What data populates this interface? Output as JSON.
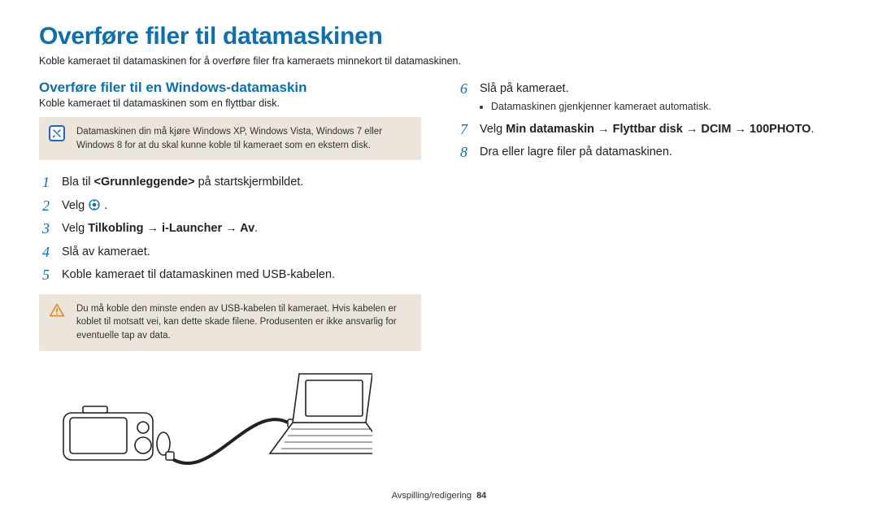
{
  "page_title": "Overføre filer til datamaskinen",
  "intro": "Koble kameraet til datamaskinen for å overføre filer fra kameraets minnekort til datamaskinen.",
  "left": {
    "section_title": "Overføre filer til en Windows-datamaskin",
    "sub_intro": "Koble kameraet til datamaskinen som en flyttbar disk.",
    "info_note": "Datamaskinen din må kjøre Windows XP, Windows Vista, Windows 7 eller Windows 8 for at du skal kunne koble til kameraet som en ekstern disk.",
    "steps": {
      "s1_a": "Bla til ",
      "s1_b": "<Grunnleggende>",
      "s1_c": " på startskjermbildet.",
      "s2": "Velg ",
      "s3_a": "Velg ",
      "s3_b": "Tilkobling → i-Launcher → Av",
      "s3_c": ".",
      "s4": "Slå av kameraet.",
      "s5": "Koble kameraet til datamaskinen med USB-kabelen."
    },
    "warn_note": "Du må koble den minste enden av USB-kabelen til kameraet. Hvis kabelen er koblet til motsatt vei, kan dette skade filene. Produsenten er ikke ansvarlig for eventuelle tap av data."
  },
  "right": {
    "steps": {
      "s6": "Slå på kameraet.",
      "s6_bullet": "Datamaskinen gjenkjenner kameraet automatisk.",
      "s7_a": "Velg ",
      "s7_b": "Min datamaskin → Flyttbar disk → DCIM → 100PHOTO",
      "s7_c": ".",
      "s8": "Dra eller lagre filer på datamaskinen."
    }
  },
  "footer_section": "Avspilling/redigering",
  "footer_page": "84"
}
